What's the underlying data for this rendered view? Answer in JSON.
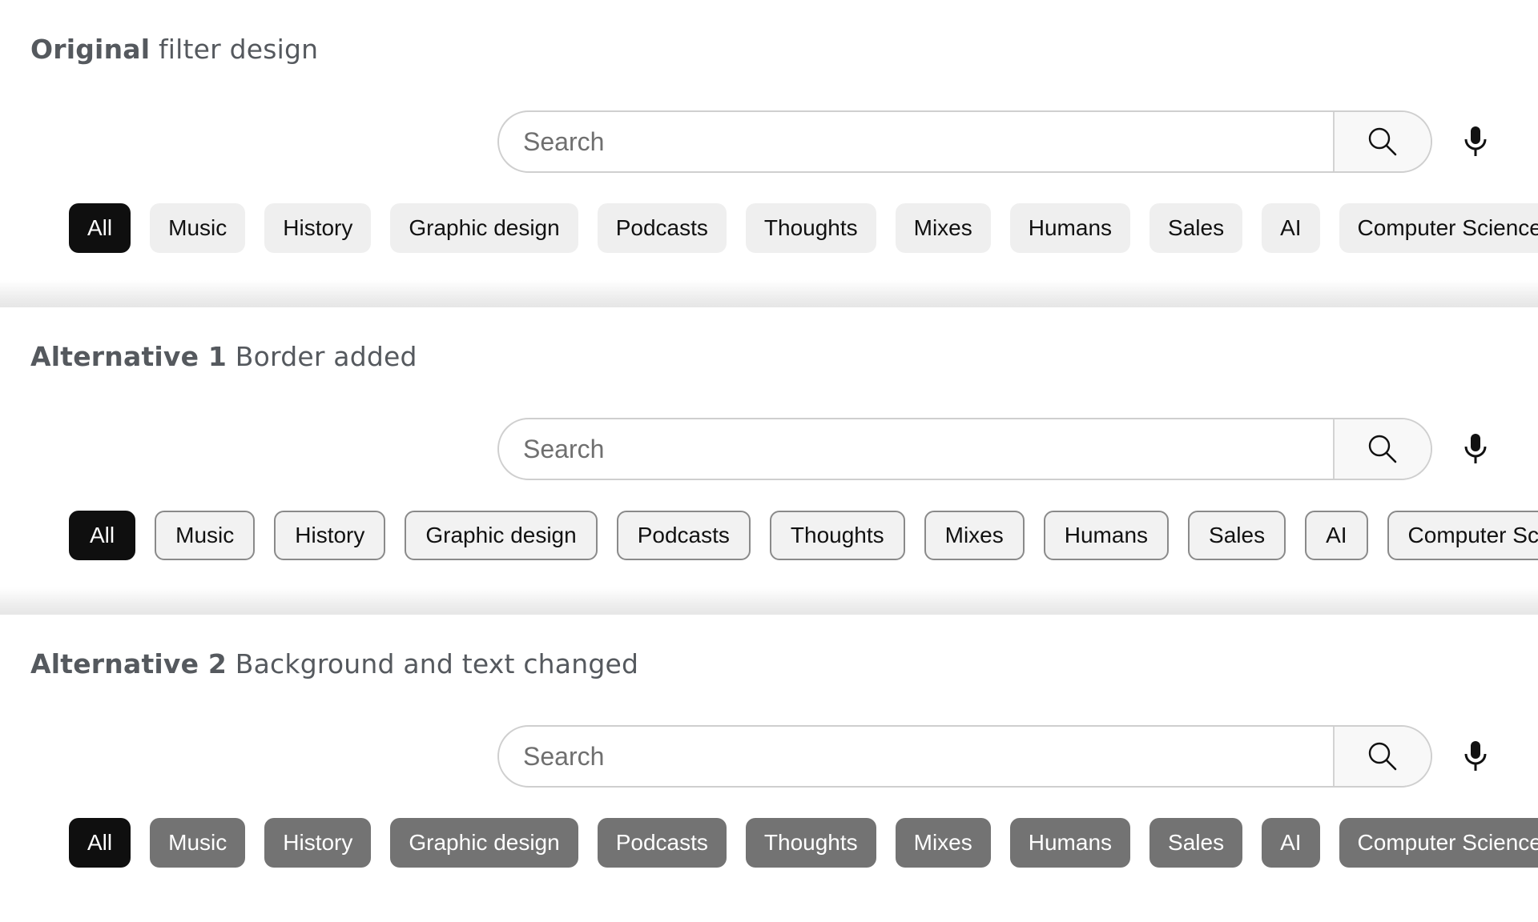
{
  "search": {
    "placeholder": "Search"
  },
  "sections": [
    {
      "title_bold": "Original",
      "title_rest": "filter design",
      "chips": [
        "All",
        "Music",
        "History",
        "Graphic design",
        "Podcasts",
        "Thoughts",
        "Mixes",
        "Humans",
        "Sales",
        "AI",
        "Computer Science"
      ]
    },
    {
      "title_bold": "Alternative 1",
      "title_rest": "Border added",
      "chips": [
        "All",
        "Music",
        "History",
        "Graphic design",
        "Podcasts",
        "Thoughts",
        "Mixes",
        "Humans",
        "Sales",
        "AI",
        "Computer Science"
      ]
    },
    {
      "title_bold": "Alternative 2",
      "title_rest": "Background and text changed",
      "chips": [
        "All",
        "Music",
        "History",
        "Graphic design",
        "Podcasts",
        "Thoughts",
        "Mixes",
        "Humans",
        "Sales",
        "AI",
        "Computer Science"
      ]
    }
  ],
  "icons": {
    "search": "search-icon",
    "mic": "microphone-icon"
  },
  "colors": {
    "chip_active": "#0f0f0f",
    "chip_default": "#efefef",
    "chip_alt2": "#737373",
    "heading": "#55595e"
  }
}
